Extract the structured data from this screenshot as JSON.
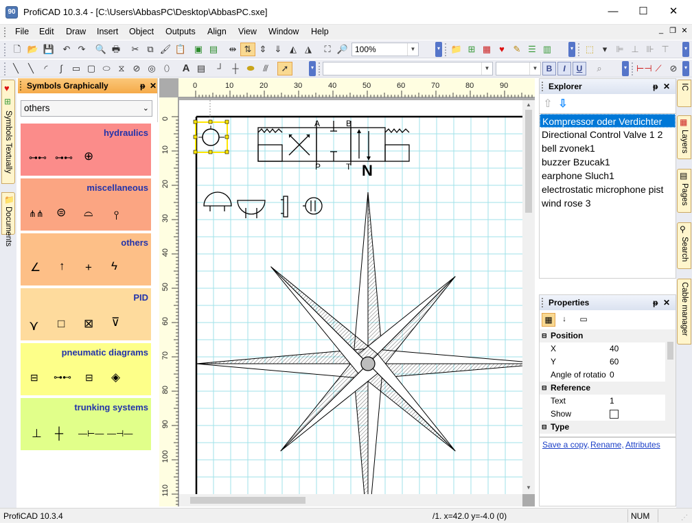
{
  "window": {
    "title": "ProfiCAD 10.3.4 - [C:\\Users\\AbbasPC\\Desktop\\AbbasPC.sxe]",
    "app_icon_text": "90",
    "minimize": "—",
    "maximize": "☐",
    "close": "✕"
  },
  "menu": {
    "items": [
      "File",
      "Edit",
      "Draw",
      "Insert",
      "Object",
      "Outputs",
      "Align",
      "View",
      "Window",
      "Help"
    ],
    "mdi_minimize": "_",
    "mdi_restore": "❐",
    "mdi_close": "✕"
  },
  "toolbar": {
    "zoom_value": "100%",
    "font_name": "",
    "font_size": "",
    "bold": "B",
    "italic": "I",
    "underline": "U"
  },
  "left_tabs": [
    {
      "label": "Symbols Textually"
    },
    {
      "label": "Documents"
    }
  ],
  "symbols_panel": {
    "title": "Symbols Graphically",
    "pin": "ᵽ",
    "close": "✕",
    "category": "others",
    "groups": [
      {
        "name": "hydraulics",
        "color": "#fb8c8a",
        "symbols": [
          "⊶⊷",
          "⊶⊷",
          "⊕"
        ]
      },
      {
        "name": "miscellaneous",
        "color": "#fba582",
        "symbols": [
          "⋔⋔",
          "⊜",
          "⌓",
          "⫯"
        ]
      },
      {
        "name": "others",
        "color": "#fdbf87",
        "symbols": [
          "∠",
          "↑",
          "+",
          "ϟ"
        ]
      },
      {
        "name": "PID",
        "color": "#fedb9d",
        "symbols": [
          "⋎",
          "□",
          "⊠",
          "⊽"
        ]
      },
      {
        "name": "pneumatic diagrams",
        "color": "#fdff89",
        "symbols": [
          "⊟",
          "⊶⊷",
          "⊟",
          "◈"
        ]
      },
      {
        "name": "trunking systems",
        "color": "#e1ff8a",
        "symbols": [
          "⊥",
          "┼",
          "—⊢—",
          "—⊣—"
        ]
      }
    ]
  },
  "ruler": {
    "top_labels": [
      "0",
      "10",
      "20",
      "30",
      "40",
      "50",
      "60",
      "70",
      "80",
      "90"
    ],
    "left_labels": [
      "0",
      "10",
      "20",
      "30",
      "40",
      "50",
      "60",
      "70",
      "80",
      "90",
      "100",
      "110"
    ]
  },
  "drawing": {
    "valve_labels": {
      "a": "A",
      "b": "B",
      "p": "P",
      "t": "T"
    },
    "north_label": "N"
  },
  "explorer": {
    "title": "Explorer",
    "pin": "ᵽ",
    "close": "✕",
    "items": [
      "Kompressor oder Verdichter",
      "Directional Control Valve 1 2",
      "bell zvonek1",
      "buzzer Bzucak1",
      "earphone Sluch1",
      "electrostatic microphone pist",
      "wind rose 3"
    ],
    "selected_index": 0
  },
  "properties": {
    "title": "Properties",
    "pin": "ᵽ",
    "close": "✕",
    "sections": {
      "position": "Position",
      "reference": "Reference",
      "type": "Type"
    },
    "rows": {
      "x_name": "X",
      "x_value": "40",
      "y_name": "Y",
      "y_value": "60",
      "angle_name": "Angle of rotatio",
      "angle_value": "0",
      "text_name": "Text",
      "text_value": "1",
      "show_name": "Show"
    }
  },
  "links": {
    "save_copy": "Save a copy,",
    "rename": "Rename,",
    "attributes": "Attributes"
  },
  "right_tabs": [
    {
      "label": "IC"
    },
    {
      "label": "Layers"
    },
    {
      "label": "Pages"
    },
    {
      "label": "Search"
    },
    {
      "label": "Cable manager"
    }
  ],
  "status": {
    "left": "ProfiCAD 10.3.4",
    "coords": "/1.  x=42.0  y=-4.0 (0)",
    "num": "NUM"
  },
  "colors": {
    "accent": "#f5aa49",
    "selection": "#0078d7",
    "link": "#1b3fc7",
    "grid": "#9fe2e8"
  }
}
